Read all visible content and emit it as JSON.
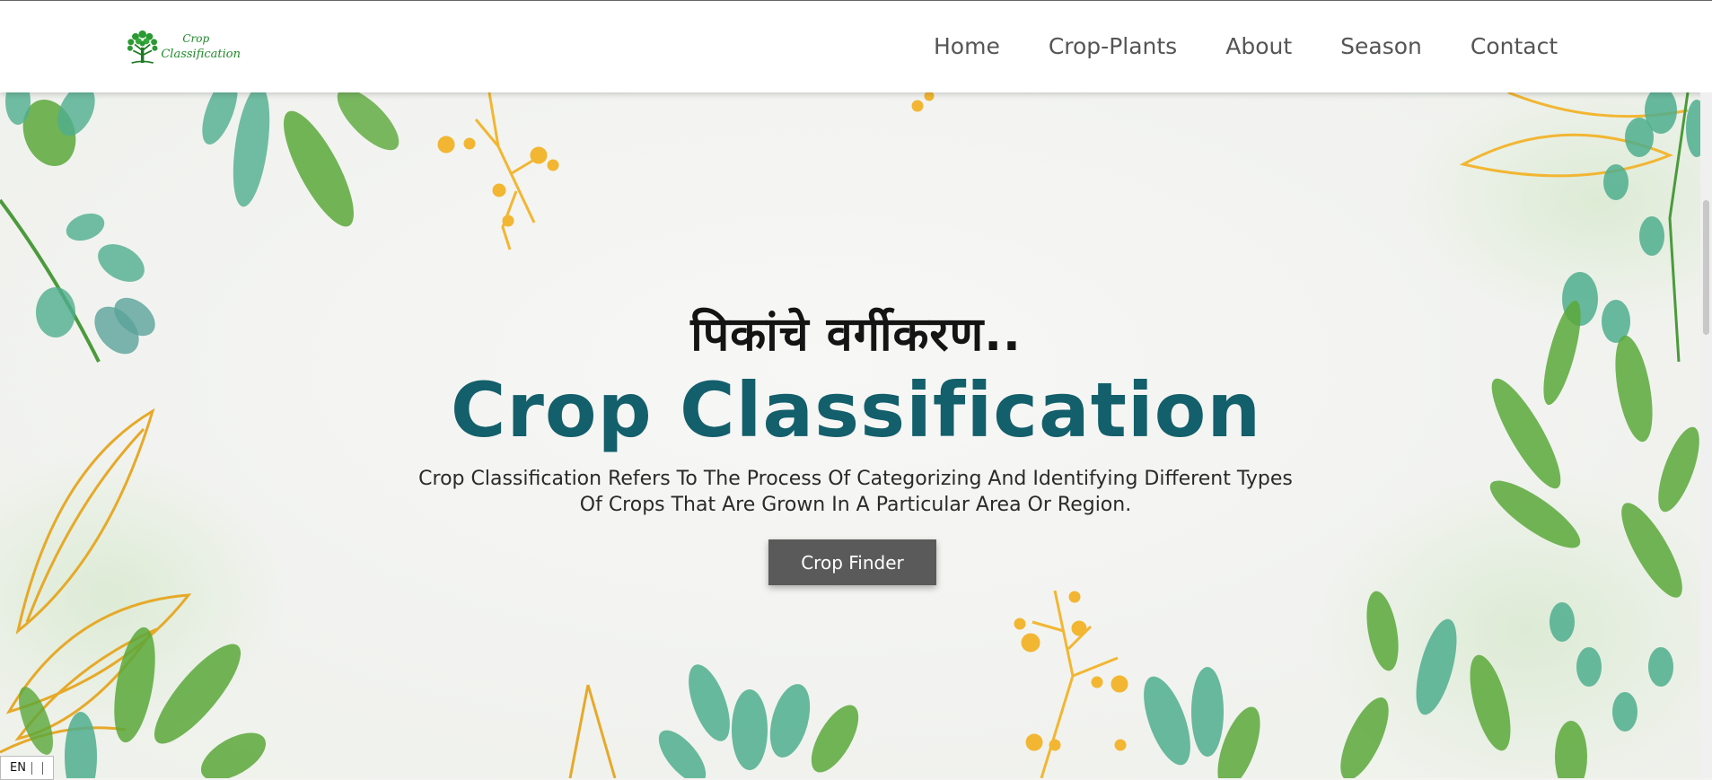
{
  "logo": {
    "line1": "Crop",
    "line2": "Classification",
    "icon": "tree-logo-icon"
  },
  "nav": {
    "items": [
      {
        "label": "Home"
      },
      {
        "label": "Crop-Plants"
      },
      {
        "label": "About"
      },
      {
        "label": "Season"
      },
      {
        "label": "Contact"
      }
    ]
  },
  "hero": {
    "subtitle": "पिकांचे वर्गीकरण..",
    "title": "Crop Classification",
    "description": "Crop Classification Refers To The Process Of Categorizing And Identifying Different Types Of Crops That Are Grown In A Particular Area Or Region.",
    "button_label": "Crop Finder"
  },
  "language_indicator": {
    "label": "EN"
  },
  "colors": {
    "title": "#135f6b",
    "button_bg": "#5a5a5a",
    "logo_green": "#1f8a2a",
    "leaf_green": "#5aa83a",
    "leaf_teal": "#4fae8e",
    "gold": "#f2b632"
  }
}
